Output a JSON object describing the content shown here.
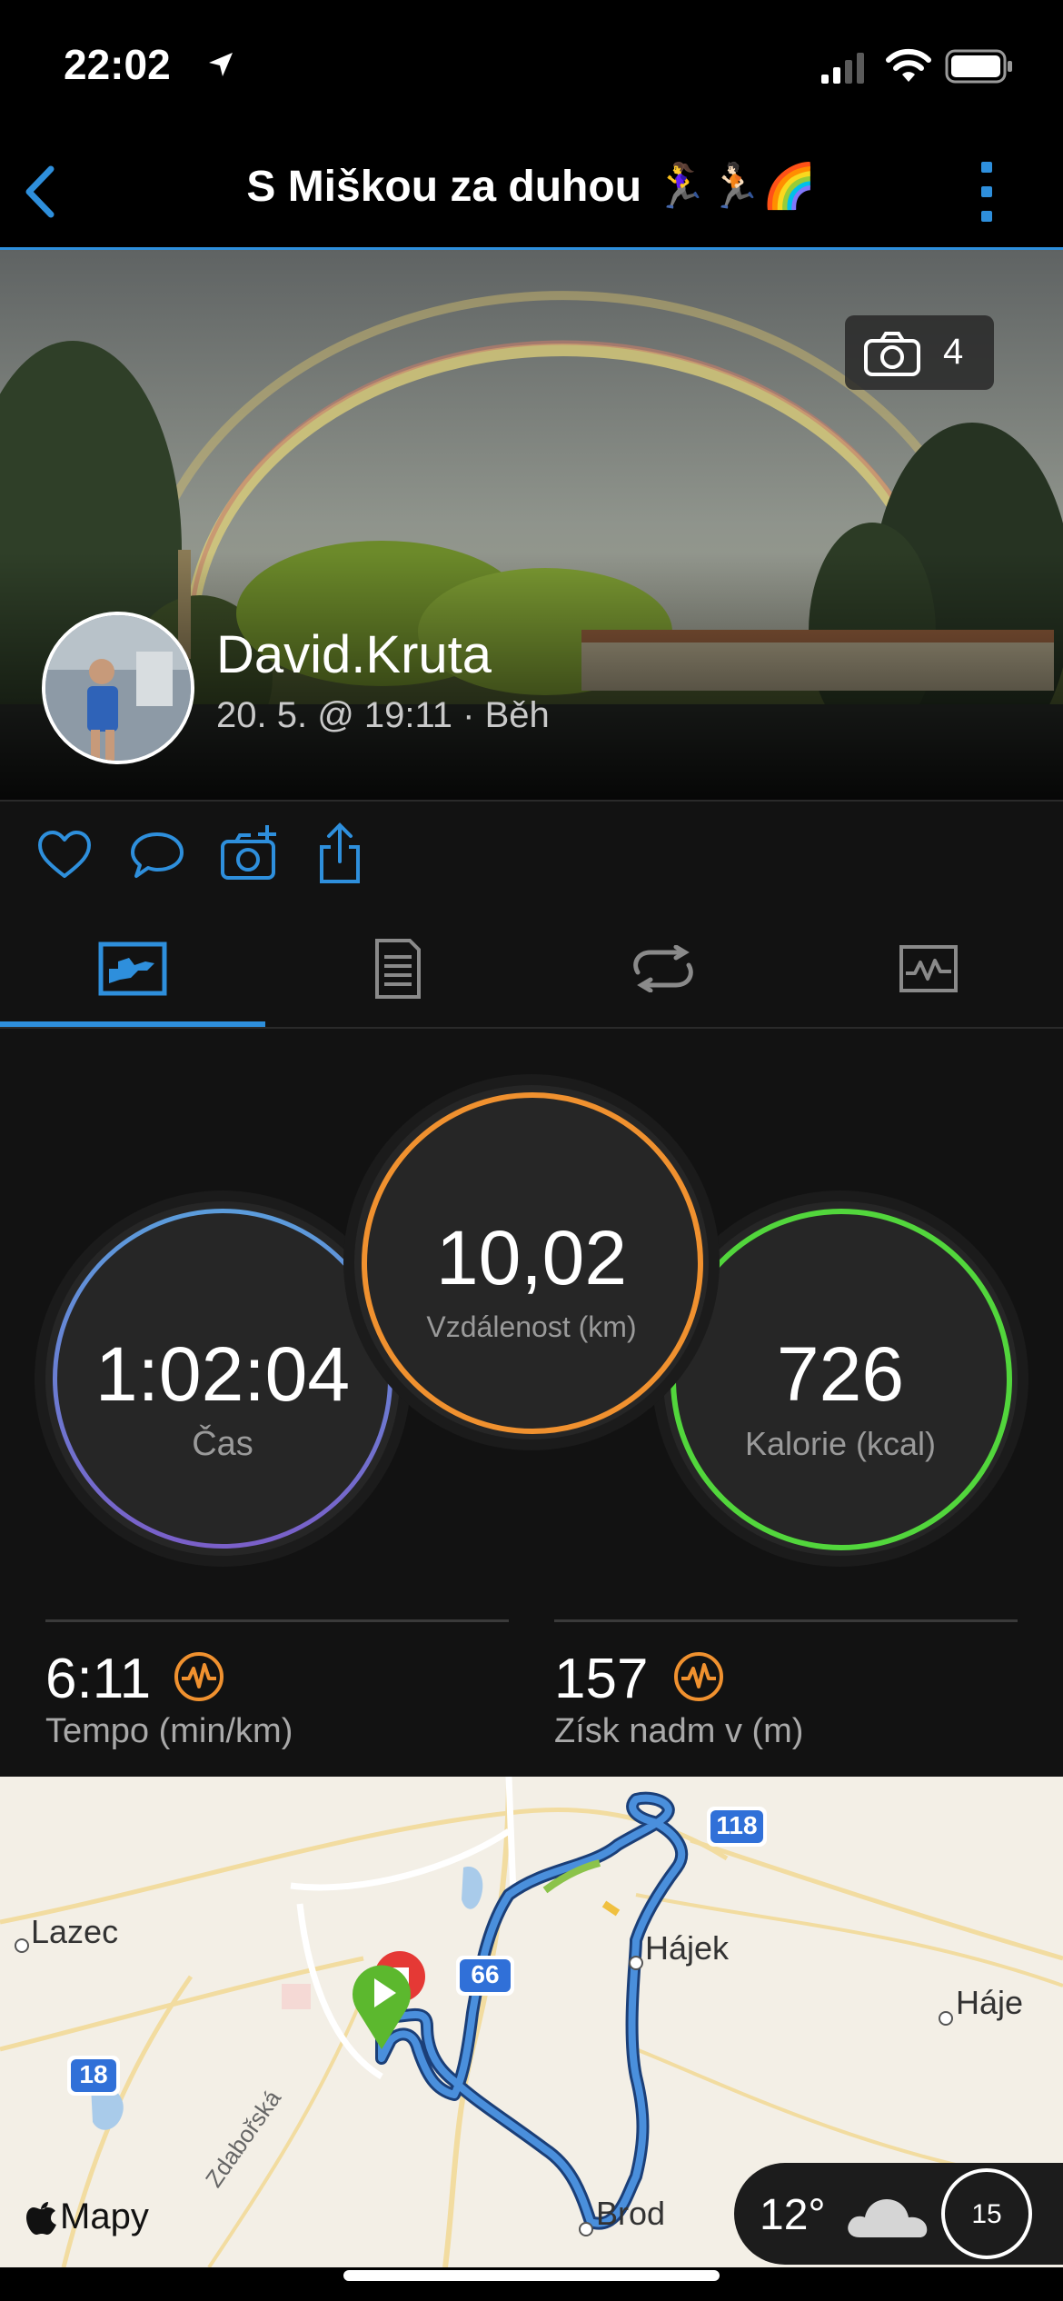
{
  "status_bar": {
    "time": "22:02"
  },
  "nav": {
    "title": "S Miškou za duhou 🏃‍♀️🏃🏻🌈"
  },
  "photo": {
    "count": "4"
  },
  "user": {
    "name": "David.Kruta",
    "meta": "20. 5. @ 19:11 · Běh"
  },
  "stats": {
    "time": {
      "value": "1:02:04",
      "label": "Čas"
    },
    "distance": {
      "value": "10,02",
      "label": "Vzdálenost (km)"
    },
    "calories": {
      "value": "726",
      "label": "Kalorie (kcal)"
    }
  },
  "metrics": {
    "pace": {
      "value": "6:11",
      "label": "Tempo (min/km)"
    },
    "elevation": {
      "value": "157",
      "label": "Získ nadm v (m)"
    }
  },
  "map": {
    "places": {
      "lazec": "Lazec",
      "hajek": "Hájek",
      "haje": "Háje",
      "brod": "Brod",
      "street": "Zdabořská"
    },
    "road_numbers": {
      "r118": "118",
      "r66": "66",
      "r18": "18"
    },
    "attribution": "Mapy",
    "weather": {
      "temp": "12°",
      "aqi": "15"
    }
  },
  "colors": {
    "accent": "#2e8fdc",
    "time_ring": "#5b8bd6",
    "distance_ring": "#f0912f",
    "calories_ring": "#52d63c"
  }
}
